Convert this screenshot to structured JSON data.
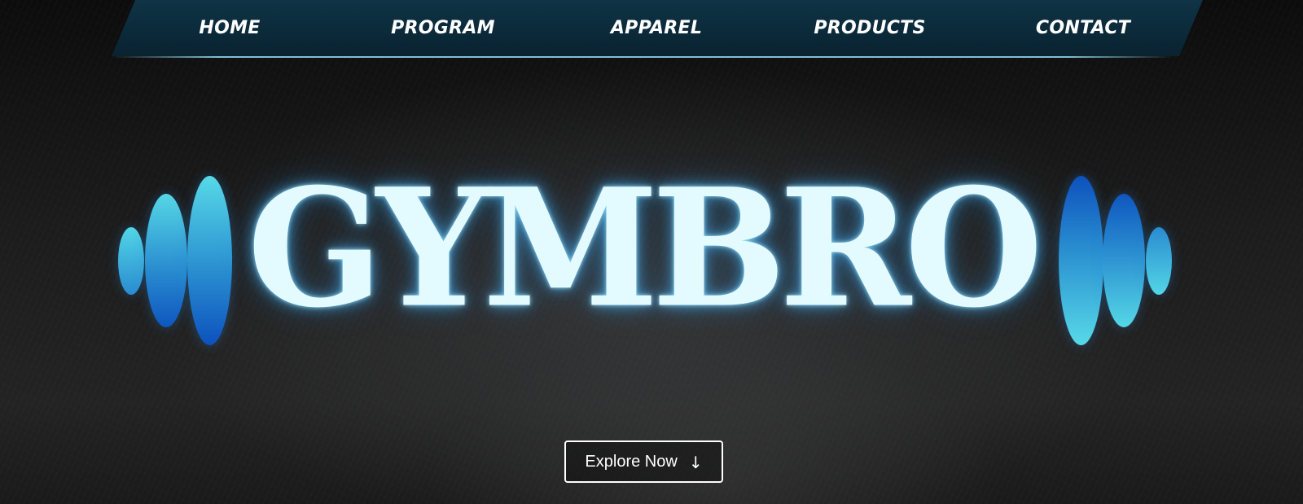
{
  "nav": {
    "items": [
      {
        "label": "HOME"
      },
      {
        "label": "PROGRAM"
      },
      {
        "label": "APPAREL"
      },
      {
        "label": "PRODUCTS"
      },
      {
        "label": "CONTACT"
      }
    ]
  },
  "hero": {
    "logo_text": "GYMBRO",
    "cta": {
      "label": "Explore Now",
      "icon": "arrow-down-icon",
      "icon_glyph": "↓"
    }
  },
  "colors": {
    "background": "#1a1a1a",
    "nav_tab": "#0f3446",
    "logo_text": "#e3fbff",
    "accent_cyan": "#55d7e6",
    "accent_blue": "#0e56bf",
    "button_border": "#ffffff"
  }
}
